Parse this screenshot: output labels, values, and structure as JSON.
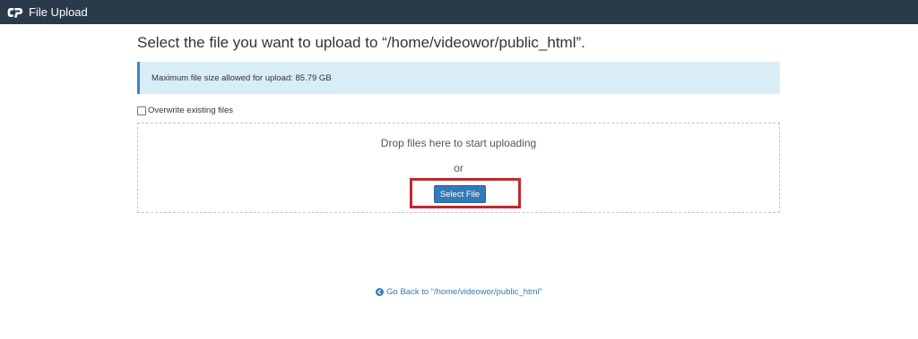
{
  "header": {
    "logo_icon": "cpanel-logo-icon",
    "title": "File Upload",
    "background": "#293a4a"
  },
  "main": {
    "heading": "Select the file you want to upload to “/home/videowor/public_html”.",
    "info_alert": "Maximum file size allowed for upload: 85.79 GB",
    "overwrite_label": "Overwrite existing files",
    "overwrite_checked": false,
    "dropzone": {
      "drop_text": "Drop files here to start uploading",
      "or_text": "or",
      "select_button_label": "Select File",
      "highlight_color": "#c0282d"
    },
    "go_back": {
      "icon": "circle-arrow-left-icon",
      "label": "Go Back to “/home/videowor/public_html”"
    }
  }
}
